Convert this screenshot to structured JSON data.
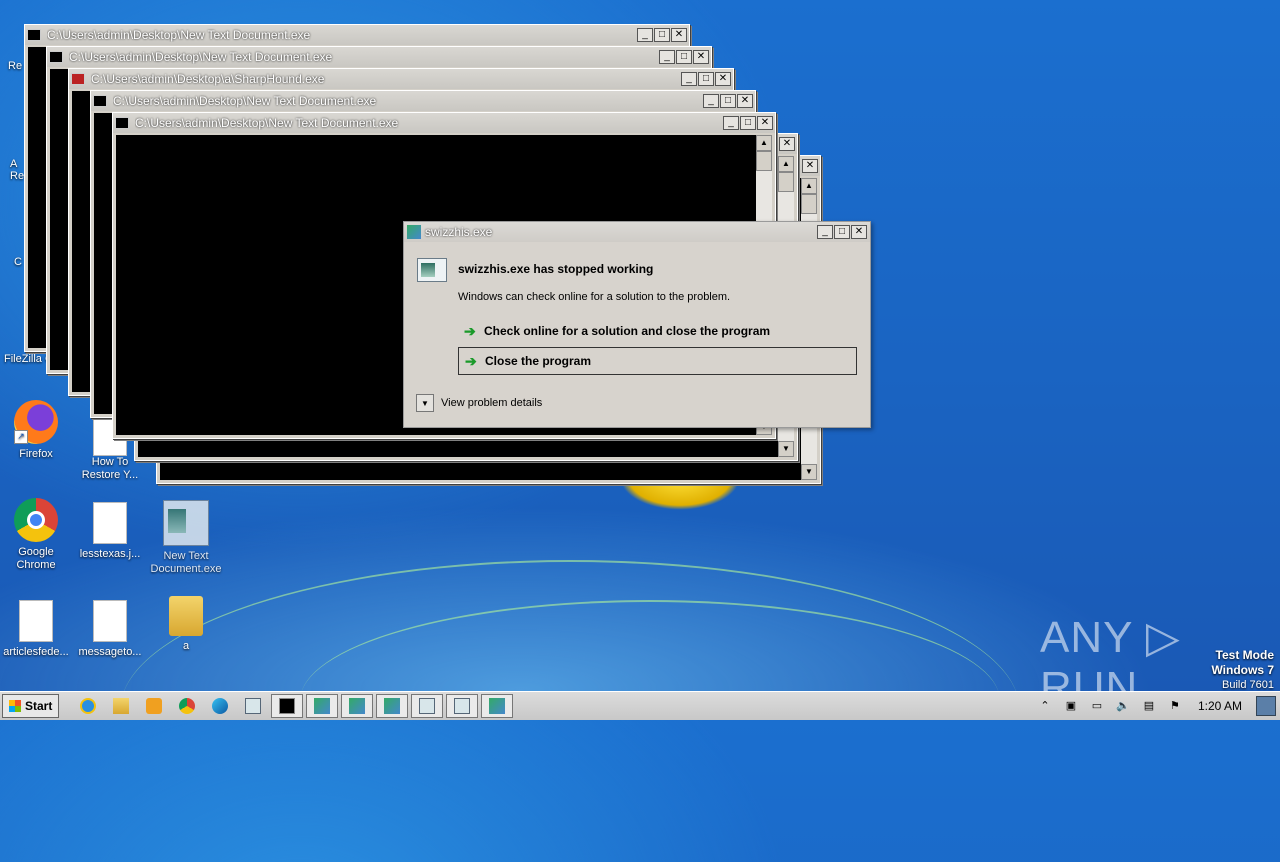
{
  "desktop": {
    "icons": [
      {
        "label": "Firefox"
      },
      {
        "label": "How To Restore Y..."
      },
      {
        "label": "Google Chrome"
      },
      {
        "label": "lesstexas.j..."
      },
      {
        "label": "New Text Document.exe"
      },
      {
        "label": "articlesfede..."
      },
      {
        "label": "messageto..."
      },
      {
        "label": "a"
      }
    ],
    "partial_labels": {
      "re": "Re",
      "a_re": "A Re",
      "c": "C",
      "filezilla": "FileZilla C"
    }
  },
  "consoles": [
    {
      "title": "C:\\Users\\admin\\Desktop\\New Text Document.exe"
    },
    {
      "title": "C:\\Users\\admin\\Desktop\\New Text Document.exe"
    },
    {
      "title": "C:\\Users\\admin\\Desktop\\a\\SharpHound.exe"
    },
    {
      "title": "C:\\Users\\admin\\Desktop\\New Text Document.exe"
    },
    {
      "title": "C:\\Users\\admin\\Desktop\\New Text Document.exe"
    }
  ],
  "dialog": {
    "title": "swizzhis.exe",
    "heading": "swizzhis.exe has stopped working",
    "description": "Windows can check online for a solution to the problem.",
    "option_check": "Check online for a solution and close the program",
    "option_close": "Close the program",
    "details": "View problem details"
  },
  "watermark": {
    "brand": "ANY ▷ RUN",
    "test_mode": "Test Mode",
    "os": "Windows 7",
    "build": "Build 7601"
  },
  "taskbar": {
    "start_label": "Start",
    "clock": "1:20 AM"
  }
}
